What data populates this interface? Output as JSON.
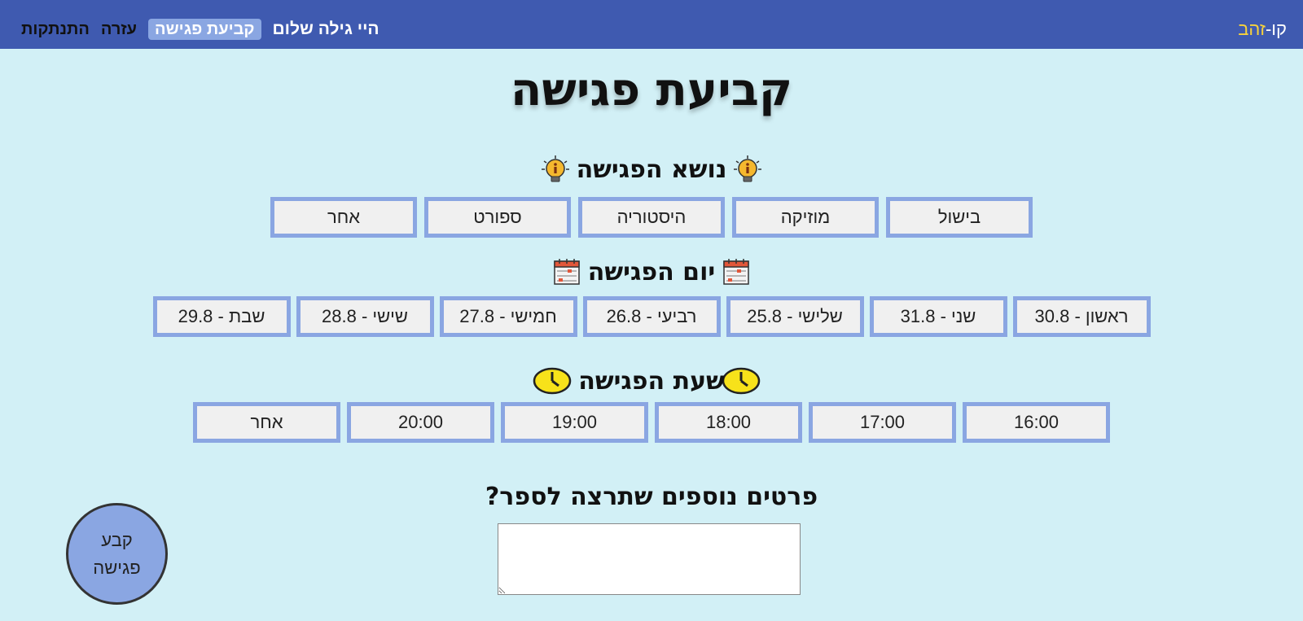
{
  "nav": {
    "brand_prefix": "קו-",
    "brand_gold": "זהב",
    "greeting": "היי גילה שלום",
    "links": [
      "קביעת פגישה",
      "עזרה",
      "התנתקות"
    ],
    "active_index": 0,
    "brand_gold_color": "#f7d23c",
    "bar_color": "#3f5ab0"
  },
  "page": {
    "title": "קביעת פגישה"
  },
  "topic": {
    "title": "נושא הפגישה",
    "icon": "lightbulb-info-icon",
    "options": [
      "בישול",
      "מוזיקה",
      "היסטוריה",
      "ספורט",
      "אחר"
    ]
  },
  "day": {
    "title": "יום הפגישה",
    "icon": "calendar-icon",
    "options": [
      "ראשון - 30.8",
      "שני - 31.8",
      "שלישי - 25.8",
      "רביעי - 26.8",
      "חמישי - 27.8",
      "שישי - 28.8",
      "שבת - 29.8"
    ]
  },
  "time": {
    "title": "שעת הפגישה",
    "icon": "clock-icon",
    "options": [
      "16:00",
      "17:00",
      "18:00",
      "19:00",
      "20:00",
      "אחר"
    ]
  },
  "details": {
    "title": "פרטים נוספים שתרצה לספר?",
    "value": ""
  },
  "submit": {
    "label": "קבע\nפגישה"
  },
  "colors": {
    "background": "#d2f0f6",
    "option_border": "#8aa6e2",
    "option_fill": "#f0f0f0"
  }
}
